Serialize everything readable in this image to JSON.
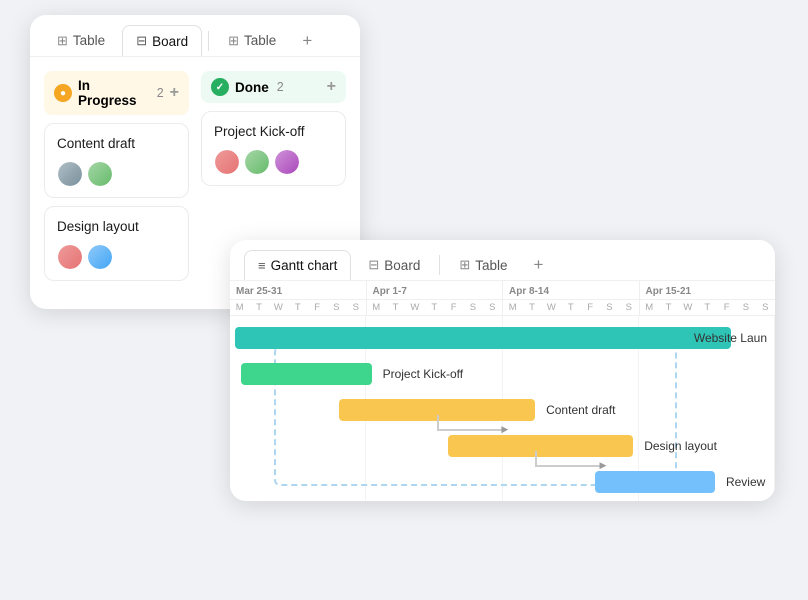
{
  "board": {
    "tabs": [
      {
        "label": "Table",
        "icon": "⊞",
        "active": false
      },
      {
        "label": "Board",
        "icon": "⊟",
        "active": true
      },
      {
        "label": "Table",
        "icon": "⊞",
        "active": false
      }
    ],
    "add_tab": "+",
    "columns": [
      {
        "id": "in-progress",
        "label": "In Progress",
        "count": "2",
        "style": "orange",
        "cards": [
          {
            "title": "Content draft",
            "avatars": [
              "av1",
              "av2"
            ]
          },
          {
            "title": "Design layout",
            "avatars": [
              "av3",
              "av4"
            ]
          }
        ]
      },
      {
        "id": "done",
        "label": "Done",
        "count": "2",
        "style": "green",
        "cards": [
          {
            "title": "Project Kick-off",
            "avatars": [
              "av3",
              "av2",
              "av5"
            ]
          }
        ]
      }
    ]
  },
  "gantt": {
    "tabs": [
      {
        "label": "Gantt chart",
        "icon": "≡",
        "active": true
      },
      {
        "label": "Board",
        "icon": "⊟",
        "active": false
      },
      {
        "label": "Table",
        "icon": "⊞",
        "active": false
      }
    ],
    "add_tab": "+",
    "weeks": [
      {
        "label": "Mar 25-31",
        "days": [
          "M",
          "T",
          "W",
          "T",
          "F",
          "S",
          "S"
        ]
      },
      {
        "label": "Apr 1-7",
        "days": [
          "M",
          "T",
          "W",
          "T",
          "F",
          "S",
          "S"
        ]
      },
      {
        "label": "Apr 8-14",
        "days": [
          "M",
          "T",
          "W",
          "T",
          "F",
          "S",
          "S"
        ]
      },
      {
        "label": "Apr 15-21",
        "days": [
          "M",
          "T",
          "W",
          "T",
          "F",
          "S",
          "S"
        ]
      }
    ],
    "bars": [
      {
        "label": "Website Laun",
        "color": "teal",
        "leftPct": 0,
        "widthPct": 92
      },
      {
        "label": "Project Kick-off",
        "color": "green",
        "leftPct": 2,
        "widthPct": 26
      },
      {
        "label": "Content draft",
        "color": "yellow",
        "leftPct": 22,
        "widthPct": 38
      },
      {
        "label": "Design layout",
        "color": "yellow",
        "leftPct": 42,
        "widthPct": 36
      },
      {
        "label": "Review",
        "color": "blue",
        "leftPct": 68,
        "widthPct": 24
      }
    ]
  }
}
